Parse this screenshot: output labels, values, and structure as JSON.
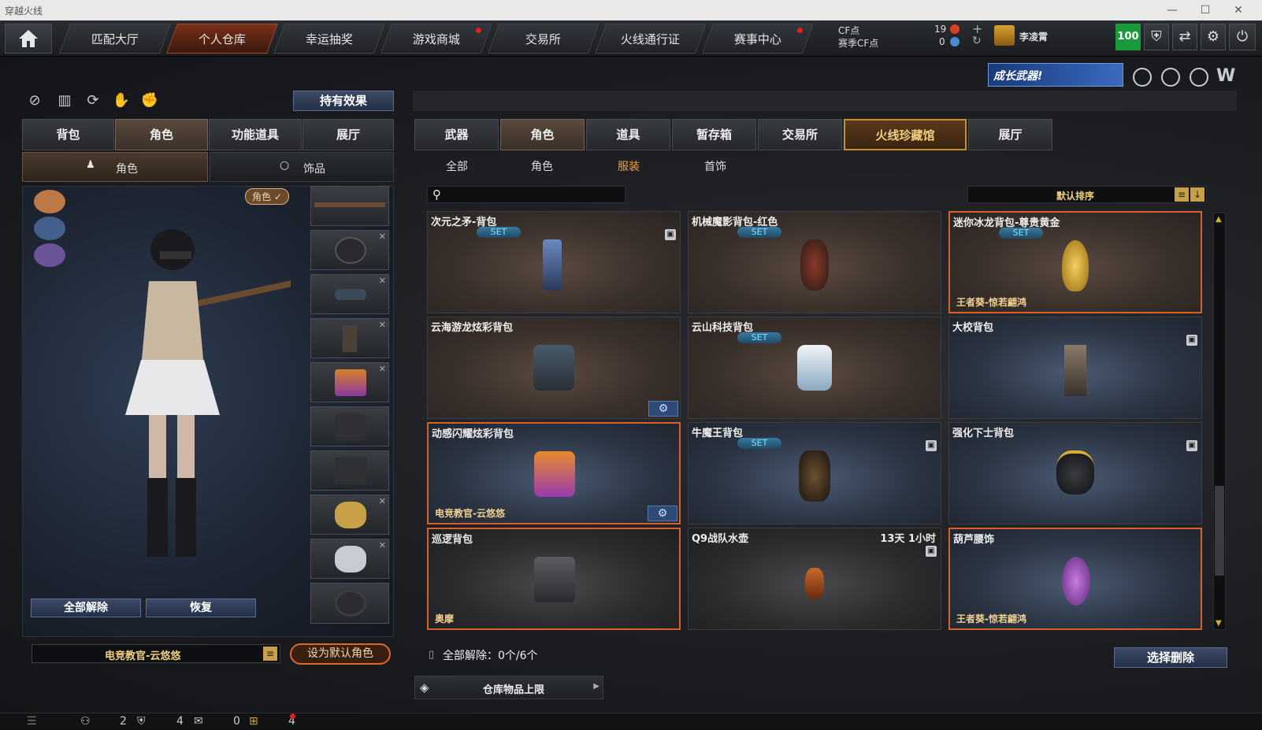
{
  "window": {
    "title": "穿越火线",
    "min": "—",
    "max": "☐",
    "close": "✕"
  },
  "nav": {
    "tabs": [
      {
        "label": "匹配大厅"
      },
      {
        "label": "个人仓库"
      },
      {
        "label": "幸运抽奖"
      },
      {
        "label": "游戏商城"
      },
      {
        "label": "交易所"
      },
      {
        "label": "火线通行证"
      },
      {
        "label": "赛事中心"
      }
    ],
    "cf_label": "CF点",
    "season_cf_label": "赛季CF点",
    "cf_value": "19",
    "season_cf_value": "0",
    "username": "李凌霄",
    "level_badge": "100",
    "colors": {
      "active_tab": "#7a2f18",
      "level_green": "#1a9a3a"
    }
  },
  "banner": {
    "text": "成长武器!"
  },
  "left": {
    "effect_button": "持有效果",
    "tabs": [
      "背包",
      "角色",
      "功能道具",
      "展厅"
    ],
    "subtabs": [
      "角色",
      "饰品"
    ],
    "role_badge": "角色 ✓",
    "unequip_all": "全部解除",
    "restore": "恢复",
    "character_name": "电竞教官-云悠悠",
    "set_default": "设为默认角色"
  },
  "right": {
    "tabs": [
      "武器",
      "角色",
      "道具",
      "暂存箱",
      "交易所",
      "火线珍藏馆",
      "展厅"
    ],
    "subtabs": [
      "全部",
      "角色",
      "服装",
      "首饰"
    ],
    "search_placeholder": "",
    "sort_label": "默认排序",
    "items": [
      {
        "name": "次元之矛-背包",
        "set": "SET",
        "owner": "",
        "time": ""
      },
      {
        "name": "机械魔影背包-红色",
        "set": "SET",
        "owner": "",
        "time": ""
      },
      {
        "name": "迷你冰龙背包-尊贵黄金",
        "set": "SET",
        "owner": "王者葵-惊若翩鸿",
        "time": ""
      },
      {
        "name": "云海游龙炫彩背包",
        "set": "",
        "owner": "",
        "time": ""
      },
      {
        "name": "云山科技背包",
        "set": "SET",
        "owner": "",
        "time": ""
      },
      {
        "name": "大校背包",
        "set": "",
        "owner": "",
        "time": ""
      },
      {
        "name": "动感闪耀炫彩背包",
        "set": "",
        "owner": "电竞教官-云悠悠",
        "time": ""
      },
      {
        "name": "牛魔王背包",
        "set": "SET",
        "owner": "",
        "time": ""
      },
      {
        "name": "强化下士背包",
        "set": "",
        "owner": "",
        "time": ""
      },
      {
        "name": "巡逻背包",
        "set": "",
        "owner": "奥摩",
        "time": ""
      },
      {
        "name": "Q9战队水壶",
        "set": "",
        "owner": "",
        "time": "13天 1小时"
      },
      {
        "name": "葫芦腰饰",
        "set": "",
        "owner": "王者葵-惊若翩鸿",
        "time": ""
      }
    ],
    "unequip_status": "全部解除：0个/6个",
    "select_delete": "选择删除",
    "storage_limit": "仓库物品上限"
  },
  "bottom": {
    "val1": "2",
    "val2": "4",
    "val3": "0",
    "val4": "4"
  },
  "icons": {
    "home": "home-icon",
    "shield": "shield-icon",
    "settings": "gear-icon",
    "power": "power-icon",
    "search": "search-icon",
    "trash": "trash-icon"
  }
}
